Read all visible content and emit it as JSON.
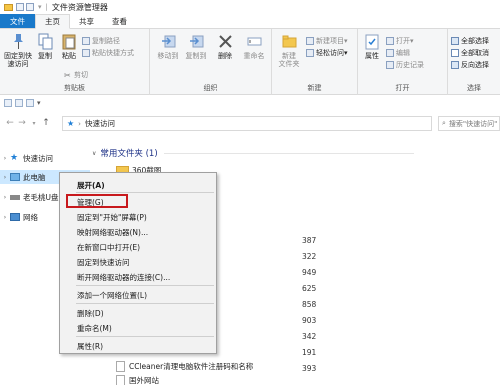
{
  "window": {
    "title": "文件资源管理器"
  },
  "tabs": [
    "文件",
    "主页",
    "共享",
    "查看"
  ],
  "ribbon": {
    "clipboard": {
      "pin": "固定到快\n速访问",
      "copy": "复制",
      "paste": "粘贴",
      "copy_path": "复制路径",
      "paste_shortcut": "粘贴快捷方式",
      "cut": "剪切",
      "label": "剪贴板"
    },
    "organize": {
      "move_to": "移动到",
      "copy_to": "复制到",
      "delete": "删除",
      "rename": "重命名",
      "label": "组织"
    },
    "new": {
      "new_folder": "新建\n文件夹",
      "new_item": "新建项目",
      "easy_access": "轻松访问",
      "label": "新建"
    },
    "open": {
      "properties": "属性",
      "open": "打开",
      "edit": "编辑",
      "history": "历史记录",
      "label": "打开"
    },
    "select": {
      "select_all": "全部选择",
      "select_none": "全部取消",
      "invert": "反向选择",
      "label": "选择"
    }
  },
  "address": {
    "path": "快速访问",
    "search_placeholder": "搜索\"快速访问\""
  },
  "nav": {
    "items": [
      {
        "label": "快速访问"
      },
      {
        "label": "此电脑"
      },
      {
        "label": "老毛桃U盘"
      },
      {
        "label": "网络"
      }
    ]
  },
  "content": {
    "section_title": "常用文件夹 (1)",
    "folder_name": "360截图",
    "numbers": [
      "387",
      "322",
      "949",
      "625",
      "858",
      "903",
      "342",
      "191",
      "393"
    ],
    "files": [
      "CCleaner清理电脑软件注册码和名称",
      "国外网站"
    ]
  },
  "context_menu": {
    "items": [
      "展开(A)",
      "管理(G)",
      "固定到\"开始\"屏幕(P)",
      "映射网络驱动器(N)...",
      "在新窗口中打开(E)",
      "固定到快速访问",
      "断开网络驱动器的连接(C)...",
      "添加一个网络位置(L)",
      "删除(D)",
      "重命名(M)",
      "属性(R)"
    ]
  },
  "colors": {
    "accent": "#1979ca",
    "selection": "#cce8ff",
    "highlight_box": "#c8191d"
  }
}
